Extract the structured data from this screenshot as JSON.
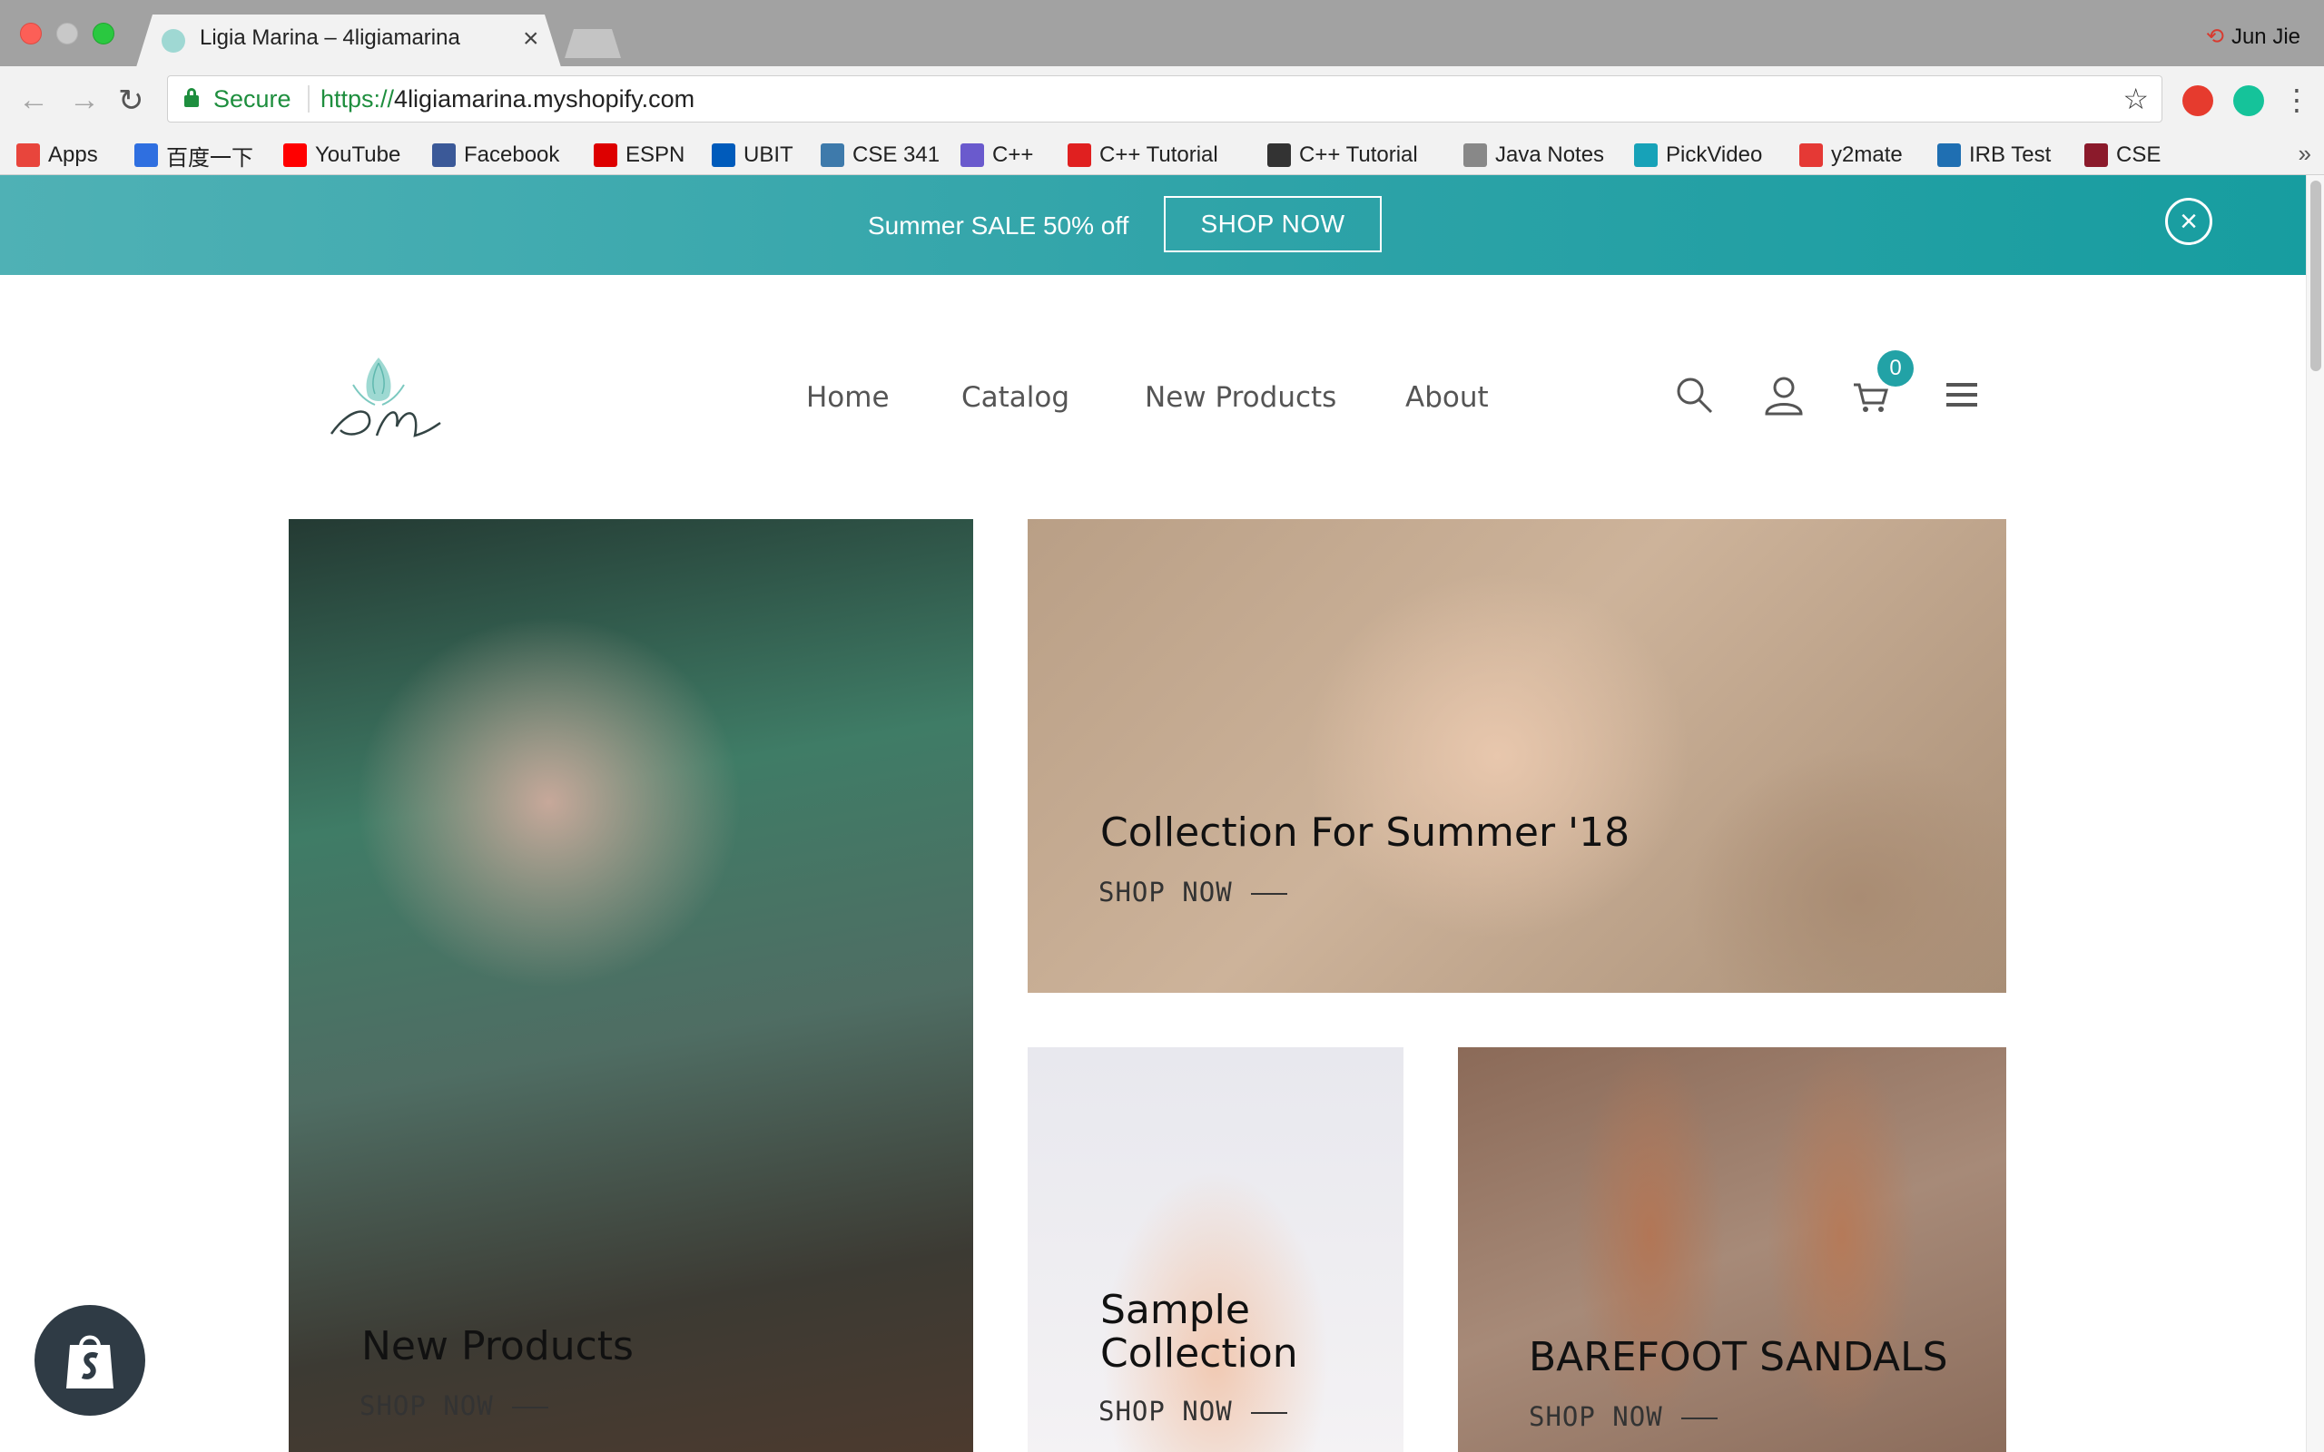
{
  "browser": {
    "tab_title": "Ligia Marina – 4ligiamarina",
    "tab_close": "×",
    "profile_name": "Jun Jie",
    "security_label": "Secure",
    "url_scheme": "https://",
    "url_host": "4ligiamarina.myshopify.com",
    "bookmarks": [
      {
        "label": "Apps",
        "icon": "apps-grid-icon",
        "color": "#e8453c"
      },
      {
        "label": "百度一下",
        "icon": "baidu-paw-icon",
        "color": "#2f6fe0"
      },
      {
        "label": "YouTube",
        "icon": "youtube-icon",
        "color": "#ff0000"
      },
      {
        "label": "Facebook",
        "icon": "facebook-icon",
        "color": "#3b5998"
      },
      {
        "label": "ESPN",
        "icon": "espn-icon",
        "color": "#d00"
      },
      {
        "label": "UBIT",
        "icon": "ub-icon",
        "color": "#005bbb"
      },
      {
        "label": "CSE 341",
        "icon": "piazza-icon",
        "color": "#3e7aab"
      },
      {
        "label": "C++",
        "icon": "cplusplus-icon",
        "color": "#6a5acd"
      },
      {
        "label": "C++ Tutorial",
        "icon": "cplusplus-red-icon",
        "color": "#e02020"
      },
      {
        "label": "C++ Tutorial",
        "icon": "diamond-icon",
        "color": "#333"
      },
      {
        "label": "Java Notes",
        "icon": "document-icon",
        "color": "#888"
      },
      {
        "label": "PickVideo",
        "icon": "pickvideo-icon",
        "color": "#17a2b8"
      },
      {
        "label": "y2mate",
        "icon": "download-icon",
        "color": "#e53935"
      },
      {
        "label": "IRB Test",
        "icon": "c-icon",
        "color": "#1f6fb2"
      },
      {
        "label": "CSE",
        "icon": "h-icon",
        "color": "#8b1a2b"
      }
    ],
    "bookmarks_more": "»"
  },
  "promo": {
    "text": "Summer SALE 50% off",
    "button": "SHOP NOW",
    "close": "×",
    "color": "#2ea3a8"
  },
  "nav": {
    "items": [
      "Home",
      "Catalog",
      "New Products",
      "About"
    ],
    "cart_count": "0",
    "badge_color": "#22a2a6"
  },
  "tiles": [
    {
      "title": "New Products",
      "link": "SHOP NOW"
    },
    {
      "title": "Collection For Summer '18",
      "link": "SHOP NOW"
    },
    {
      "title_line1": "Sample",
      "title_line2": "Collection",
      "link": "SHOP NOW"
    },
    {
      "title": "BAREFOOT SANDALS",
      "link": "SHOP NOW"
    }
  ]
}
